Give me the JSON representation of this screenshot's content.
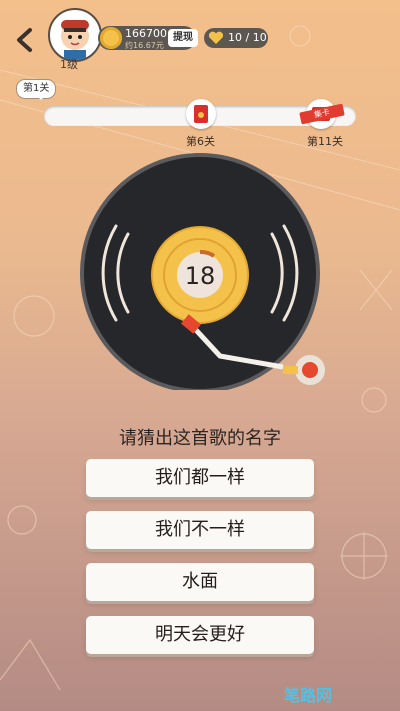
{
  "header": {
    "level": "1级",
    "coins": "166700",
    "coins_sub": "约16.67元",
    "withdraw_label": "提现",
    "lives": "10 / 10"
  },
  "progress": {
    "current_bubble": "第1关",
    "milestones": [
      "第6关",
      "第11关"
    ],
    "gift_tag": "集卡"
  },
  "player": {
    "countdown": "18"
  },
  "question": {
    "prompt": "请猜出这首歌的名字",
    "options": [
      "我们都一样",
      "我们不一样",
      "水面",
      "明天会更好"
    ]
  },
  "watermark": "笔路网",
  "colors": {
    "record": "#25272a",
    "label": "#f2b94a",
    "option_bg": "#fbf9f6"
  }
}
